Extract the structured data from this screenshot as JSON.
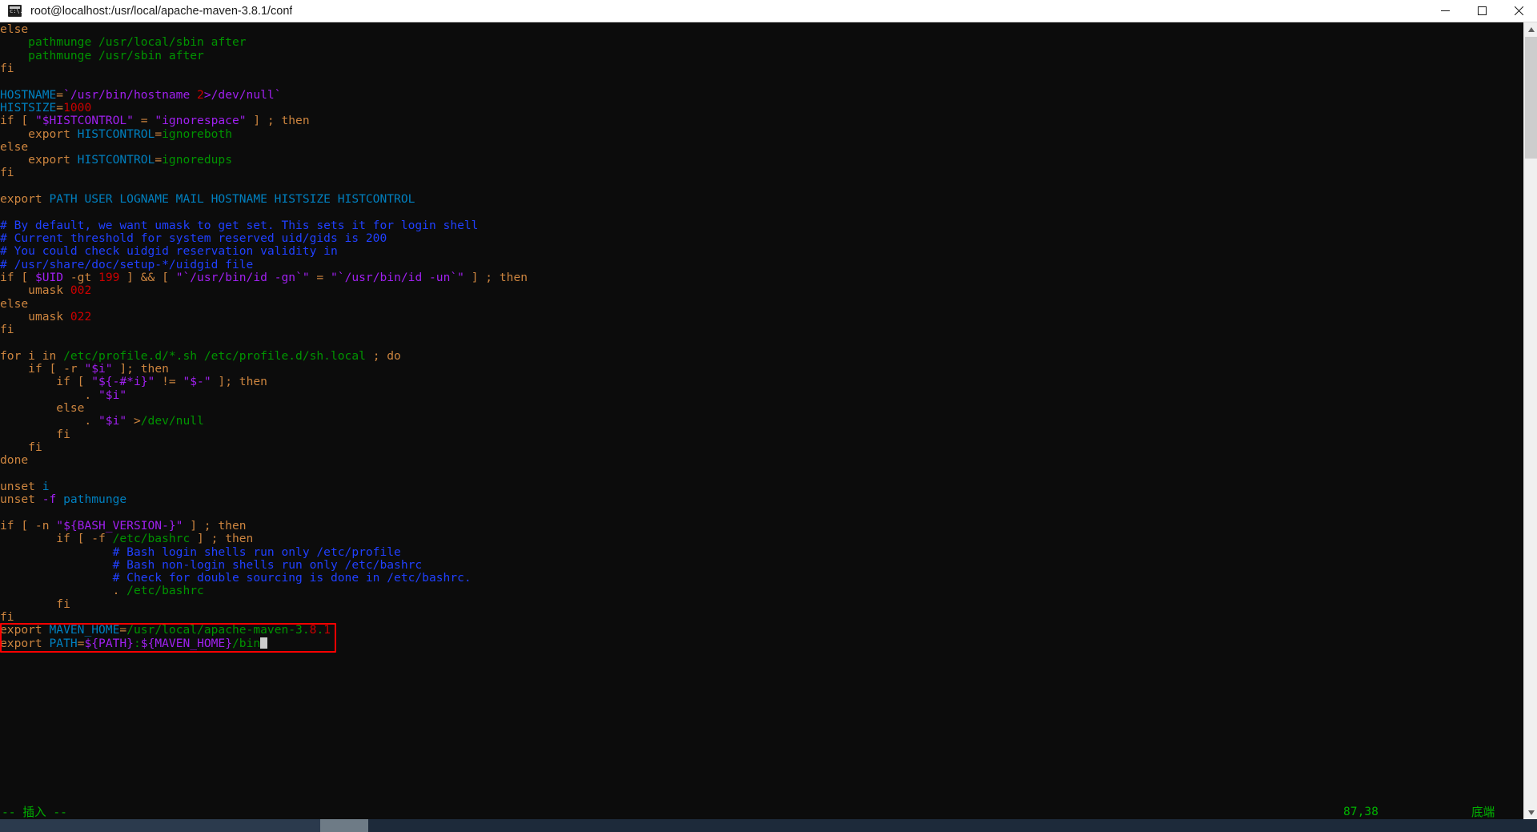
{
  "window": {
    "title": "root@localhost:/usr/local/apache-maven-3.8.1/conf",
    "icon": "console-icon",
    "minimize_label": "Minimize",
    "maximize_label": "Maximize",
    "close_label": "Close"
  },
  "editor": {
    "app": "vim",
    "file_kind": "shell-script",
    "lines": [
      [
        {
          "t": "else",
          "c": "kw"
        }
      ],
      [
        {
          "t": "    ",
          "c": "plain"
        },
        {
          "t": "pathmunge /usr/local/sbin after",
          "c": "str"
        }
      ],
      [
        {
          "t": "    ",
          "c": "plain"
        },
        {
          "t": "pathmunge /usr/sbin after",
          "c": "str"
        }
      ],
      [
        {
          "t": "fi",
          "c": "kw"
        }
      ],
      [],
      [
        {
          "t": "HOSTNAME",
          "c": "id"
        },
        {
          "t": "=",
          "c": "op"
        },
        {
          "t": "`",
          "c": "var"
        },
        {
          "t": "/usr/bin/hostname ",
          "c": "var"
        },
        {
          "t": "2",
          "c": "num"
        },
        {
          "t": ">/dev/null",
          "c": "var"
        },
        {
          "t": "`",
          "c": "var"
        }
      ],
      [
        {
          "t": "HISTSIZE",
          "c": "id"
        },
        {
          "t": "=",
          "c": "op"
        },
        {
          "t": "1000",
          "c": "num"
        }
      ],
      [
        {
          "t": "if",
          "c": "kw"
        },
        {
          "t": " [ ",
          "c": "kw"
        },
        {
          "t": "\"$HISTCONTROL\"",
          "c": "var"
        },
        {
          "t": " = ",
          "c": "kw"
        },
        {
          "t": "\"ignorespace\"",
          "c": "var"
        },
        {
          "t": " ] ; ",
          "c": "kw"
        },
        {
          "t": "then",
          "c": "kw"
        }
      ],
      [
        {
          "t": "    ",
          "c": "plain"
        },
        {
          "t": "export",
          "c": "kw"
        },
        {
          "t": " ",
          "c": "plain"
        },
        {
          "t": "HISTCONTROL",
          "c": "id"
        },
        {
          "t": "=",
          "c": "op"
        },
        {
          "t": "ignoreboth",
          "c": "str"
        }
      ],
      [
        {
          "t": "else",
          "c": "kw"
        }
      ],
      [
        {
          "t": "    ",
          "c": "plain"
        },
        {
          "t": "export",
          "c": "kw"
        },
        {
          "t": " ",
          "c": "plain"
        },
        {
          "t": "HISTCONTROL",
          "c": "id"
        },
        {
          "t": "=",
          "c": "op"
        },
        {
          "t": "ignoredups",
          "c": "str"
        }
      ],
      [
        {
          "t": "fi",
          "c": "kw"
        }
      ],
      [],
      [
        {
          "t": "export",
          "c": "kw"
        },
        {
          "t": " ",
          "c": "plain"
        },
        {
          "t": "PATH USER LOGNAME MAIL HOSTNAME HISTSIZE HISTCONTROL",
          "c": "id"
        }
      ],
      [],
      [
        {
          "t": "# By default, we want umask to get set. This sets it for login shell",
          "c": "cmt"
        }
      ],
      [
        {
          "t": "# Current threshold for system reserved uid/gids is 200",
          "c": "cmt"
        }
      ],
      [
        {
          "t": "# You could check uidgid reservation validity in",
          "c": "cmt"
        }
      ],
      [
        {
          "t": "# /usr/share/doc/setup-*/uidgid file",
          "c": "cmt"
        }
      ],
      [
        {
          "t": "if",
          "c": "kw"
        },
        {
          "t": " [ ",
          "c": "kw"
        },
        {
          "t": "$UID",
          "c": "var"
        },
        {
          "t": " -gt ",
          "c": "kw"
        },
        {
          "t": "199",
          "c": "num"
        },
        {
          "t": " ] && [ ",
          "c": "kw"
        },
        {
          "t": "\"`",
          "c": "var"
        },
        {
          "t": "/usr/bin/id -gn",
          "c": "var"
        },
        {
          "t": "`\"",
          "c": "var"
        },
        {
          "t": " = ",
          "c": "kw"
        },
        {
          "t": "\"`",
          "c": "var"
        },
        {
          "t": "/usr/bin/id -un",
          "c": "var"
        },
        {
          "t": "`\"",
          "c": "var"
        },
        {
          "t": " ] ; ",
          "c": "kw"
        },
        {
          "t": "then",
          "c": "kw"
        }
      ],
      [
        {
          "t": "    ",
          "c": "plain"
        },
        {
          "t": "umask",
          "c": "kw"
        },
        {
          "t": " ",
          "c": "plain"
        },
        {
          "t": "002",
          "c": "num"
        }
      ],
      [
        {
          "t": "else",
          "c": "kw"
        }
      ],
      [
        {
          "t": "    ",
          "c": "plain"
        },
        {
          "t": "umask",
          "c": "kw"
        },
        {
          "t": " ",
          "c": "plain"
        },
        {
          "t": "022",
          "c": "num"
        }
      ],
      [
        {
          "t": "fi",
          "c": "kw"
        }
      ],
      [],
      [
        {
          "t": "for",
          "c": "kw"
        },
        {
          "t": " i ",
          "c": "kw"
        },
        {
          "t": "in",
          "c": "kw"
        },
        {
          "t": " ",
          "c": "plain"
        },
        {
          "t": "/etc/profile.d/*.sh /etc/profile.d/sh.local",
          "c": "str"
        },
        {
          "t": " ; ",
          "c": "kw"
        },
        {
          "t": "do",
          "c": "kw"
        }
      ],
      [
        {
          "t": "    ",
          "c": "plain"
        },
        {
          "t": "if",
          "c": "kw"
        },
        {
          "t": " [ -r ",
          "c": "kw"
        },
        {
          "t": "\"$i\"",
          "c": "var"
        },
        {
          "t": " ]; ",
          "c": "kw"
        },
        {
          "t": "then",
          "c": "kw"
        }
      ],
      [
        {
          "t": "        ",
          "c": "plain"
        },
        {
          "t": "if",
          "c": "kw"
        },
        {
          "t": " [ ",
          "c": "kw"
        },
        {
          "t": "\"${-#*i}\"",
          "c": "var"
        },
        {
          "t": " != ",
          "c": "kw"
        },
        {
          "t": "\"$-\"",
          "c": "var"
        },
        {
          "t": " ]; ",
          "c": "kw"
        },
        {
          "t": "then",
          "c": "kw"
        }
      ],
      [
        {
          "t": "            . ",
          "c": "kw"
        },
        {
          "t": "\"$i\"",
          "c": "var"
        }
      ],
      [
        {
          "t": "        ",
          "c": "plain"
        },
        {
          "t": "else",
          "c": "kw"
        }
      ],
      [
        {
          "t": "            . ",
          "c": "kw"
        },
        {
          "t": "\"$i\"",
          "c": "var"
        },
        {
          "t": " >",
          "c": "kw"
        },
        {
          "t": "/dev/null",
          "c": "str"
        }
      ],
      [
        {
          "t": "        ",
          "c": "plain"
        },
        {
          "t": "fi",
          "c": "kw"
        }
      ],
      [
        {
          "t": "    ",
          "c": "plain"
        },
        {
          "t": "fi",
          "c": "kw"
        }
      ],
      [
        {
          "t": "done",
          "c": "kw"
        }
      ],
      [],
      [
        {
          "t": "unset",
          "c": "kw"
        },
        {
          "t": " ",
          "c": "plain"
        },
        {
          "t": "i",
          "c": "id"
        }
      ],
      [
        {
          "t": "unset",
          "c": "kw"
        },
        {
          "t": " ",
          "c": "plain"
        },
        {
          "t": "-f",
          "c": "var"
        },
        {
          "t": " ",
          "c": "plain"
        },
        {
          "t": "pathmunge",
          "c": "id"
        }
      ],
      [],
      [
        {
          "t": "if",
          "c": "kw"
        },
        {
          "t": " [ -n ",
          "c": "kw"
        },
        {
          "t": "\"${BASH_VERSION-}\"",
          "c": "var"
        },
        {
          "t": " ] ; ",
          "c": "kw"
        },
        {
          "t": "then",
          "c": "kw"
        }
      ],
      [
        {
          "t": "        ",
          "c": "plain"
        },
        {
          "t": "if",
          "c": "kw"
        },
        {
          "t": " [ -f ",
          "c": "kw"
        },
        {
          "t": "/etc/bashrc",
          "c": "str"
        },
        {
          "t": " ] ; ",
          "c": "kw"
        },
        {
          "t": "then",
          "c": "kw"
        }
      ],
      [
        {
          "t": "                ",
          "c": "plain"
        },
        {
          "t": "# Bash login shells run only /etc/profile",
          "c": "cmt"
        }
      ],
      [
        {
          "t": "                ",
          "c": "plain"
        },
        {
          "t": "# Bash non-login shells run only /etc/bashrc",
          "c": "cmt"
        }
      ],
      [
        {
          "t": "                ",
          "c": "plain"
        },
        {
          "t": "# Check for double sourcing is done in /etc/bashrc.",
          "c": "cmt"
        }
      ],
      [
        {
          "t": "                . ",
          "c": "kw"
        },
        {
          "t": "/etc/bashrc",
          "c": "str"
        }
      ],
      [
        {
          "t": "        ",
          "c": "plain"
        },
        {
          "t": "fi",
          "c": "kw"
        }
      ],
      [
        {
          "t": "fi",
          "c": "kw"
        }
      ],
      [
        {
          "t": "export",
          "c": "kw"
        },
        {
          "t": " ",
          "c": "plain"
        },
        {
          "t": "MAVEN_HOME",
          "c": "id"
        },
        {
          "t": "=",
          "c": "op"
        },
        {
          "t": "/usr/local/apache-maven-3.",
          "c": "str"
        },
        {
          "t": "8",
          "c": "num"
        },
        {
          "t": ".",
          "c": "str"
        },
        {
          "t": "1",
          "c": "num"
        }
      ],
      [
        {
          "t": "export",
          "c": "kw"
        },
        {
          "t": " ",
          "c": "plain"
        },
        {
          "t": "PATH",
          "c": "id"
        },
        {
          "t": "=",
          "c": "op"
        },
        {
          "t": "${PATH}",
          "c": "var"
        },
        {
          "t": ":",
          "c": "str"
        },
        {
          "t": "${MAVEN_HOME}",
          "c": "var"
        },
        {
          "t": "/bin",
          "c": "str"
        },
        {
          "t": "CURSOR",
          "c": "cursor"
        }
      ]
    ],
    "annotation": {
      "shape": "rectangle",
      "color": "#ff0000",
      "covers": "maven-export-lines"
    }
  },
  "status": {
    "mode": "-- 插入 --",
    "position": "87,38",
    "location": "底端"
  },
  "scrollbar": {
    "up_arrow": "scroll-up-arrow",
    "down_arrow": "scroll-down-arrow"
  }
}
